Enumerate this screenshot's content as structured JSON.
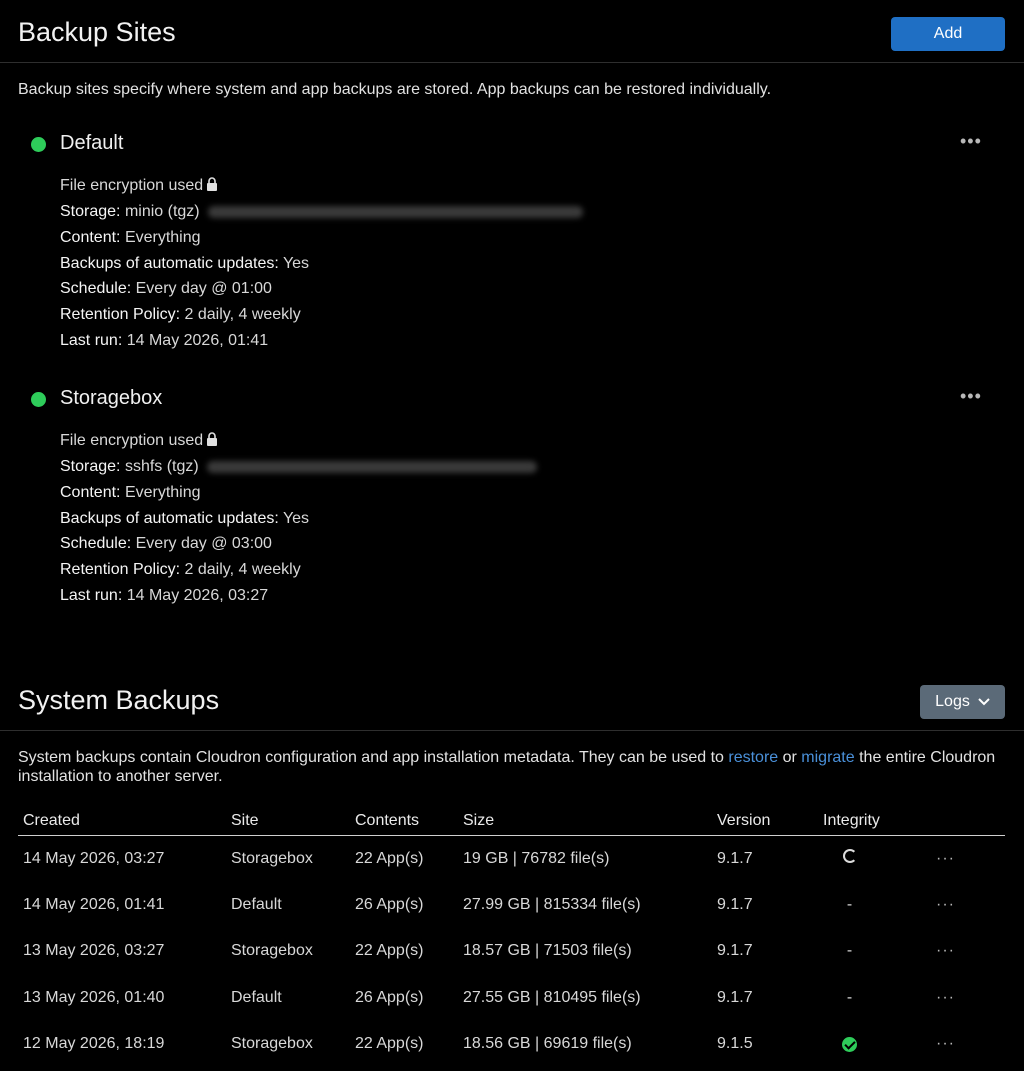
{
  "backup_sites": {
    "title": "Backup Sites",
    "add_label": "Add",
    "description": "Backup sites specify where system and app backups are stored. App backups can be restored individually.",
    "sites": [
      {
        "name": "Default",
        "status_color": "#2ecc5a",
        "encryption": "File encryption used",
        "storage_label": "Storage:",
        "storage_value": "minio (tgz)",
        "content_label": "Content:",
        "content_value": "Everything",
        "auto_label": "Backups of automatic updates:",
        "auto_value": "Yes",
        "schedule_label": "Schedule:",
        "schedule_value": "Every day @ 01:00",
        "retention_label": "Retention Policy:",
        "retention_value": "2 daily, 4 weekly",
        "lastrun_label": "Last run:",
        "lastrun_value": "14 May 2026, 01:41"
      },
      {
        "name": "Storagebox",
        "status_color": "#2ecc5a",
        "encryption": "File encryption used",
        "storage_label": "Storage:",
        "storage_value": "sshfs (tgz)",
        "content_label": "Content:",
        "content_value": "Everything",
        "auto_label": "Backups of automatic updates:",
        "auto_value": "Yes",
        "schedule_label": "Schedule:",
        "schedule_value": "Every day @ 03:00",
        "retention_label": "Retention Policy:",
        "retention_value": "2 daily, 4 weekly",
        "lastrun_label": "Last run:",
        "lastrun_value": "14 May 2026, 03:27"
      }
    ]
  },
  "system_backups": {
    "title": "System Backups",
    "logs_label": "Logs",
    "desc_part1": "System backups contain Cloudron configuration and app installation metadata. They can be used to ",
    "restore_link": "restore",
    "desc_or": " or ",
    "migrate_link": "migrate",
    "desc_part2": " the entire Cloudron installation to another server.",
    "columns": [
      "Created",
      "Site",
      "Contents",
      "Size",
      "Version",
      "Integrity"
    ],
    "rows": [
      {
        "created": "14 May 2026, 03:27",
        "site": "Storagebox",
        "contents": "22 App(s)",
        "size": "19 GB | 76782 file(s)",
        "version": "9.1.7",
        "integrity": "checking"
      },
      {
        "created": "14 May 2026, 01:41",
        "site": "Default",
        "contents": "26 App(s)",
        "size": "27.99 GB | 815334 file(s)",
        "version": "9.1.7",
        "integrity": "-"
      },
      {
        "created": "13 May 2026, 03:27",
        "site": "Storagebox",
        "contents": "22 App(s)",
        "size": "18.57 GB | 71503 file(s)",
        "version": "9.1.7",
        "integrity": "-"
      },
      {
        "created": "13 May 2026, 01:40",
        "site": "Default",
        "contents": "26 App(s)",
        "size": "27.55 GB | 810495 file(s)",
        "version": "9.1.7",
        "integrity": "-"
      },
      {
        "created": "12 May 2026, 18:19",
        "site": "Storagebox",
        "contents": "22 App(s)",
        "size": "18.56 GB | 69619 file(s)",
        "version": "9.1.5",
        "integrity": "verified"
      }
    ],
    "more_label": "···"
  }
}
